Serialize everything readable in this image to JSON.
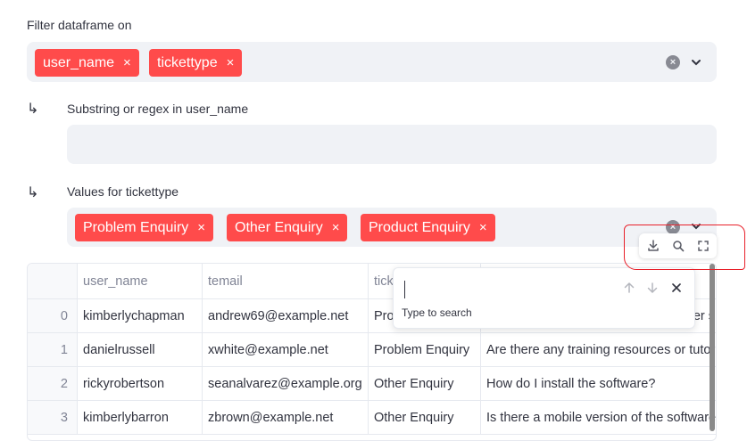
{
  "filter": {
    "label": "Filter dataframe on",
    "chips": [
      "user_name",
      "tickettype"
    ],
    "remove_glyph": "×",
    "clear_glyph": "×"
  },
  "substring": {
    "label": "Substring or regex in user_name",
    "value": ""
  },
  "values": {
    "label": "Values for tickettype",
    "chips": [
      "Problem Enquiry",
      "Other Enquiry",
      "Product Enquiry"
    ]
  },
  "indent_glyph": "↳",
  "table": {
    "columns": [
      "user_name",
      "temail",
      "tick",
      ""
    ],
    "rows": [
      {
        "index": "0",
        "user_name": "kimberlychapman",
        "email": "andrew69@example.net",
        "tickettype": "Pro",
        "question": "er s"
      },
      {
        "index": "1",
        "user_name": "danielrussell",
        "email": "xwhite@example.net",
        "tickettype": "Problem Enquiry",
        "question": "Are there any training resources or tutor"
      },
      {
        "index": "2",
        "user_name": "rickyrobertson",
        "email": "seanalvarez@example.org",
        "tickettype": "Other Enquiry",
        "question": "How do I install the software?"
      },
      {
        "index": "3",
        "user_name": "kimberlybarron",
        "email": "zbrown@example.net",
        "tickettype": "Other Enquiry",
        "question": "Is there a mobile version of the software"
      }
    ]
  },
  "toolbar": {
    "icons": [
      "download-icon",
      "search-icon",
      "fullscreen-icon"
    ]
  },
  "search_popup": {
    "hint": "Type to search",
    "close_glyph": "×"
  },
  "colors": {
    "accent": "#ff4b4b",
    "input_bg": "#f0f2f6",
    "annotation": "#e8202a"
  }
}
